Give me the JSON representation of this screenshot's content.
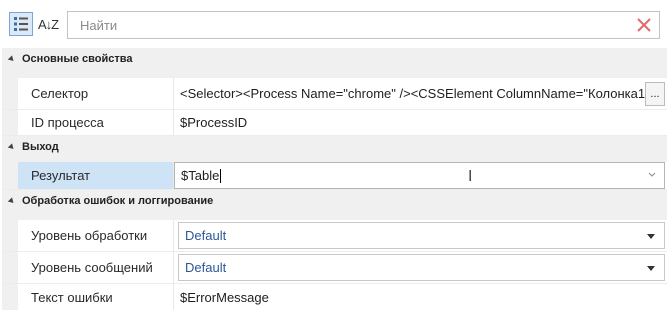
{
  "toolbar": {
    "categorized_icon": "categorized-grid-icon",
    "sort_label": "A↓Z",
    "sort_icon": "sort-alpha-icon",
    "search_placeholder": "Найти",
    "clear_icon": "close-icon",
    "clear_color": "#e06b6b"
  },
  "categories": {
    "main": {
      "label": "Основные свойства",
      "selector": {
        "name": "Селектор",
        "value": "<Selector><Process Name=\"chrome\" /><CSSElement ColumnName=\"Колонка1\"",
        "button": "..."
      },
      "process_id": {
        "name": "ID процесса",
        "value": "$ProcessID"
      }
    },
    "output": {
      "label": "Выход",
      "result": {
        "name": "Результат",
        "value": "$Table"
      }
    },
    "errors": {
      "label": "Обработка ошибок и логгирование",
      "handling_level": {
        "name": "Уровень обработки",
        "value": "Default"
      },
      "message_level": {
        "name": "Уровень сообщений",
        "value": "Default"
      },
      "error_text": {
        "name": "Текст ошибки",
        "value": "$ErrorMessage"
      }
    }
  },
  "colors": {
    "selection": "#cfe3f7",
    "category_bg": "#f0f0f0",
    "dropdown_value": "#2b579a"
  }
}
